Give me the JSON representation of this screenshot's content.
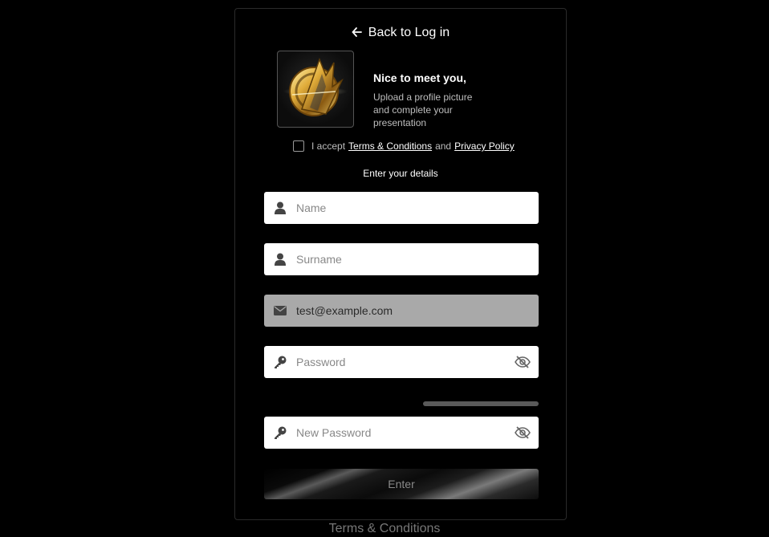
{
  "back_label": "Back to Log in",
  "greeting": {
    "title": "Nice to meet you,",
    "subtitle_lines": [
      "Upload a profile picture",
      "and complete your",
      "presentation"
    ]
  },
  "terms": {
    "prefix": "I accept",
    "terms_link": "Terms & Conditions",
    "and": "and",
    "privacy_link": "Privacy Policy",
    "checked": false
  },
  "details_heading": "Enter your details",
  "fields": {
    "name_placeholder": "Name",
    "surname_placeholder": "Surname",
    "email_value": "test@example.com",
    "password_placeholder": "Password",
    "new_password_placeholder": "New Password"
  },
  "enter_label": "Enter",
  "footer_link": "Terms & Conditions",
  "icons": {
    "back": "arrow-left-icon",
    "name": "user-icon",
    "surname": "user-icon",
    "email": "envelope-icon",
    "password": "key-icon",
    "password_toggle": "eye-slash-icon",
    "new_password": "key-icon",
    "new_password_toggle": "eye-slash-icon"
  },
  "colors": {
    "background": "#000000",
    "field_bg": "#ffffff",
    "disabled_field_bg": "#a9a9a9",
    "logo_gold": "#d4a537"
  }
}
